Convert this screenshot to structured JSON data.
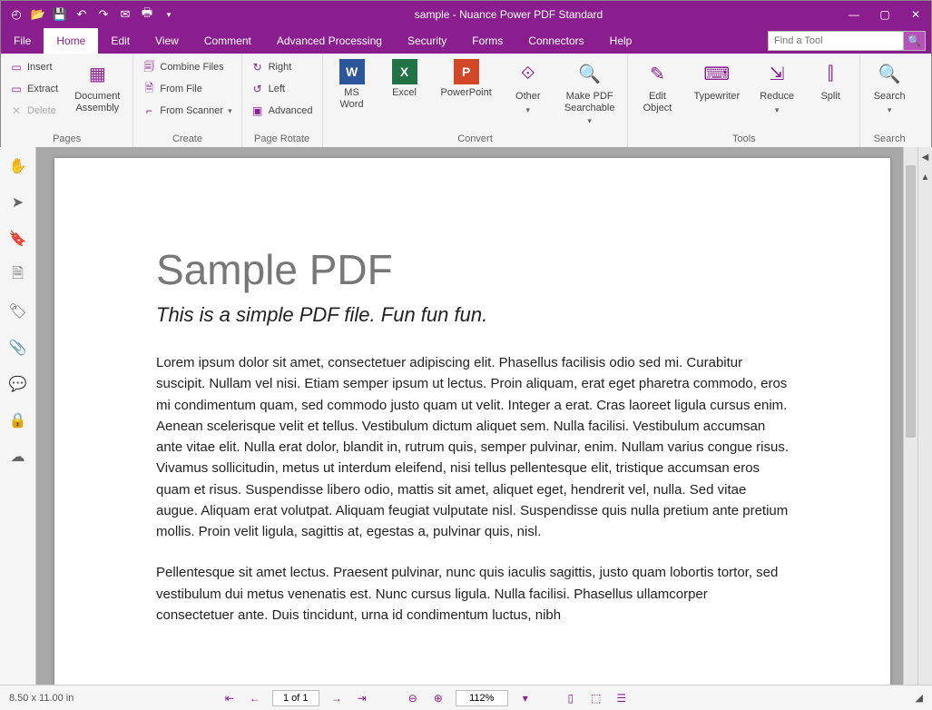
{
  "titlebar": {
    "title": "sample - Nuance Power PDF Standard"
  },
  "menu": {
    "tabs": [
      "File",
      "Home",
      "Edit",
      "View",
      "Comment",
      "Advanced Processing",
      "Security",
      "Forms",
      "Connectors",
      "Help"
    ],
    "active": 1,
    "find_placeholder": "Find a Tool"
  },
  "ribbon": {
    "pages": {
      "label": "Pages",
      "insert": "Insert",
      "extract": "Extract",
      "delete": "Delete",
      "assembly": "Document\nAssembly"
    },
    "create": {
      "label": "Create",
      "combine": "Combine Files",
      "fromfile": "From File",
      "fromscanner": "From Scanner"
    },
    "rotate": {
      "label": "Page Rotate",
      "right": "Right",
      "left": "Left",
      "advanced": "Advanced"
    },
    "convert": {
      "label": "Convert",
      "word": "MS\nWord",
      "excel": "Excel",
      "ppt": "PowerPoint",
      "other": "Other",
      "searchable": "Make PDF\nSearchable"
    },
    "tools": {
      "label": "Tools",
      "editobj": "Edit\nObject",
      "typewriter": "Typewriter",
      "reduce": "Reduce",
      "split": "Split"
    },
    "search": {
      "label": "Search",
      "search": "Search"
    }
  },
  "document": {
    "title": "Sample PDF",
    "subtitle": "This is a simple PDF file. Fun fun fun.",
    "para1": "Lorem ipsum dolor sit amet, consectetuer adipiscing elit. Phasellus facilisis odio sed mi. Curabitur suscipit. Nullam vel nisi. Etiam semper ipsum ut lectus. Proin aliquam, erat eget pharetra commodo, eros mi condimentum quam, sed commodo justo quam ut velit. Integer a erat. Cras laoreet ligula cursus enim. Aenean scelerisque velit et tellus. Vestibulum dictum aliquet sem. Nulla facilisi. Vestibulum accumsan ante vitae elit. Nulla erat dolor, blandit in, rutrum quis, semper pulvinar, enim. Nullam varius congue risus. Vivamus sollicitudin, metus ut interdum eleifend, nisi tellus pellentesque elit, tristique accumsan eros quam et risus. Suspendisse libero odio, mattis sit amet, aliquet eget, hendrerit vel, nulla. Sed vitae augue. Aliquam erat volutpat. Aliquam feugiat vulputate nisl. Suspendisse quis nulla pretium ante pretium mollis. Proin velit ligula, sagittis at, egestas a, pulvinar quis, nisl.",
    "para2": "Pellentesque sit amet lectus. Praesent pulvinar, nunc quis iaculis sagittis, justo quam lobortis tortor, sed vestibulum dui metus venenatis est. Nunc cursus ligula. Nulla facilisi. Phasellus ullamcorper consectetuer ante. Duis tincidunt, urna id condimentum luctus, nibh"
  },
  "status": {
    "dimensions": "8.50 x 11.00 in",
    "page": "1 of 1",
    "zoom": "112%"
  }
}
